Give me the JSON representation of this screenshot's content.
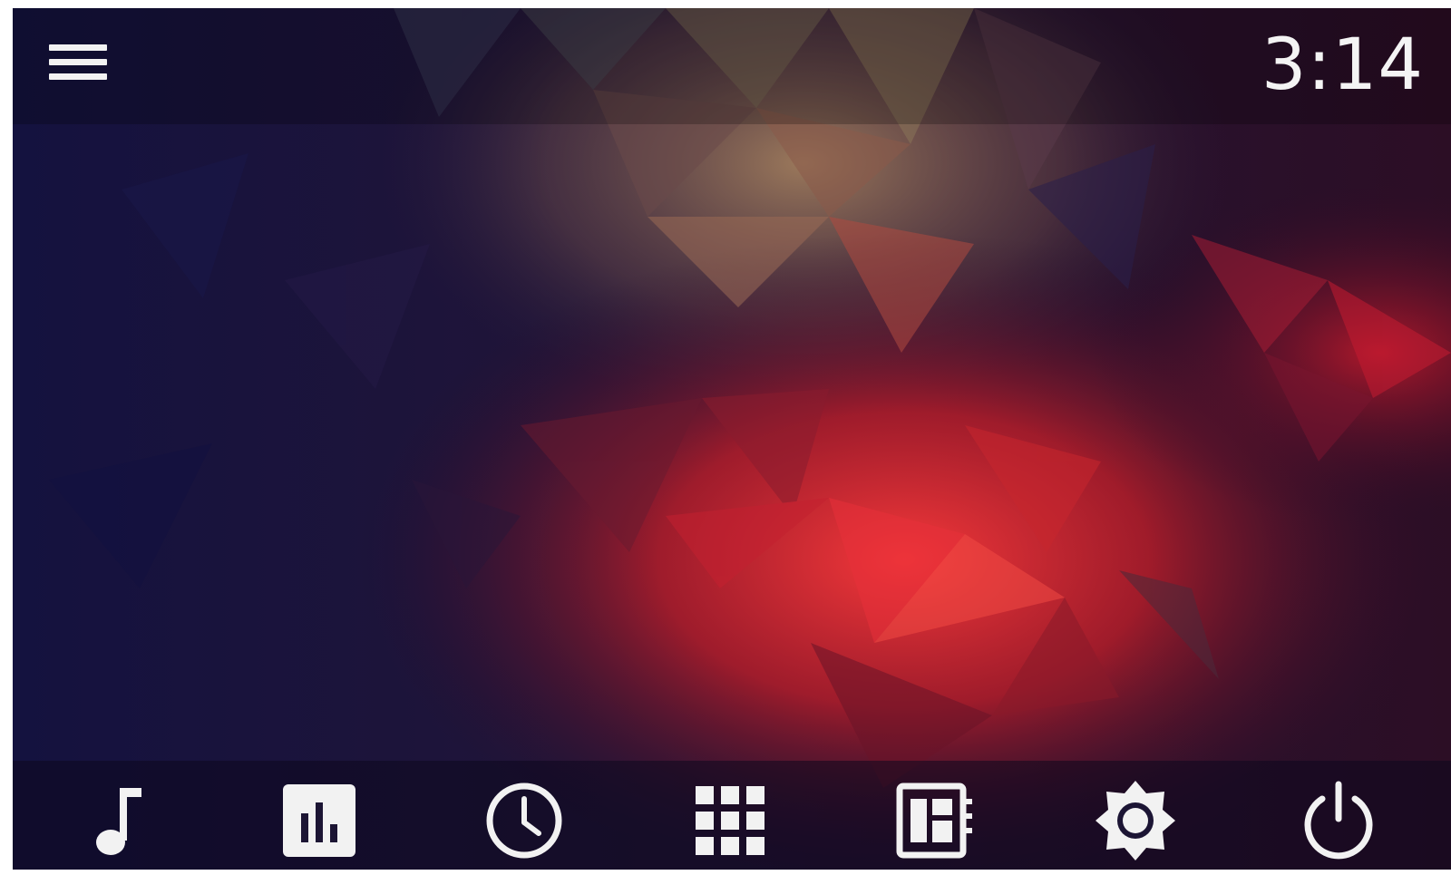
{
  "status_bar": {
    "time": "3:14",
    "menu_icon": "hamburger-menu-icon"
  },
  "dock": {
    "items": [
      {
        "id": "music",
        "icon": "music-note-icon"
      },
      {
        "id": "equalizer",
        "icon": "equalizer-icon"
      },
      {
        "id": "clock",
        "icon": "clock-icon"
      },
      {
        "id": "apps",
        "icon": "app-grid-icon"
      },
      {
        "id": "dashboard",
        "icon": "dashboard-icon"
      },
      {
        "id": "brightness",
        "icon": "brightness-icon"
      },
      {
        "id": "power",
        "icon": "power-icon"
      }
    ]
  },
  "colors": {
    "foreground": "#f2f2f2",
    "background_dark": "#151243",
    "accent_red": "#e0202c"
  }
}
